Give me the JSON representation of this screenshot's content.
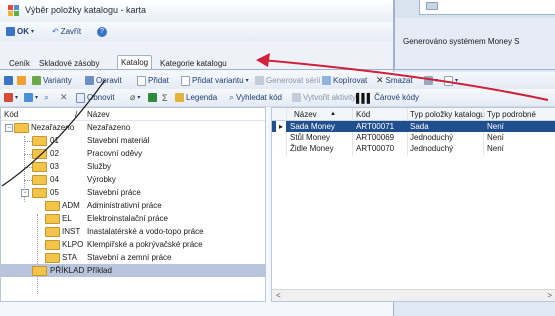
{
  "window": {
    "title": "Výběr položky katalogu - karta"
  },
  "toolbar_main": {
    "ok_label": "OK",
    "close_label": "Zavřít"
  },
  "tabs": [
    {
      "label": "Ceník"
    },
    {
      "label": "Skladové zásoby"
    },
    {
      "label": "Katalog"
    },
    {
      "label": "Kategorie katalogu"
    }
  ],
  "right_window": {
    "text": "Generováno systémem Money S"
  },
  "toolbar2": [
    {
      "label": "Varianty"
    },
    {
      "label": "Opravit"
    },
    {
      "label": "Přidat"
    },
    {
      "label": "Přidat variantu"
    },
    {
      "label": "Generovat sérii"
    },
    {
      "label": "Kopírovat"
    },
    {
      "label": "Smazat"
    }
  ],
  "toolbar3": [
    {
      "label": "Obnovit"
    },
    {
      "label": "Legenda"
    },
    {
      "label": "Vyhledat kód"
    },
    {
      "label": "Vytvořit aktivity"
    },
    {
      "label": "Čárové kódy"
    }
  ],
  "tree": {
    "headers": {
      "code": "Kód",
      "sep": "/",
      "name": "Název"
    },
    "rows": [
      {
        "code": "Nezařazeno",
        "name": "Nezařazeno"
      },
      {
        "code": "01",
        "name": "Stavební materiál"
      },
      {
        "code": "02",
        "name": "Pracovní oděvy"
      },
      {
        "code": "03",
        "name": "Služby"
      },
      {
        "code": "04",
        "name": "Výrobky"
      },
      {
        "code": "05",
        "name": "Stavební práce"
      },
      {
        "code": "ADM",
        "name": "Administrativní práce"
      },
      {
        "code": "EL",
        "name": "Elektroinstalační práce"
      },
      {
        "code": "INST",
        "name": "Inastalatérské a vodo-topo práce"
      },
      {
        "code": "KLPO",
        "name": "Klempířské a pokrývačské práce"
      },
      {
        "code": "STA",
        "name": "Stavební a zemní práce"
      },
      {
        "code": "PŘÍKLAD",
        "name": "Příklad"
      }
    ]
  },
  "grid": {
    "headers": {
      "name": "Název",
      "code": "Kód",
      "type": "Typ položky katalogu",
      "type2": "Typ podrobné"
    },
    "rows": [
      {
        "name": "Sada Money",
        "code": "ART00071",
        "type": "Sada",
        "type2": "Není"
      },
      {
        "name": "Stůl Money",
        "code": "ART00069",
        "type": "Jednoduchý",
        "type2": "Není"
      },
      {
        "name": "Židle Money",
        "code": "ART00070",
        "type": "Jednoduchý",
        "type2": "Není"
      }
    ],
    "scroll_left": "<",
    "scroll_right": ">"
  },
  "colors": {
    "accent": "#1f4f8f",
    "arrow": "#d0203a",
    "folder": "#f2c54a"
  }
}
